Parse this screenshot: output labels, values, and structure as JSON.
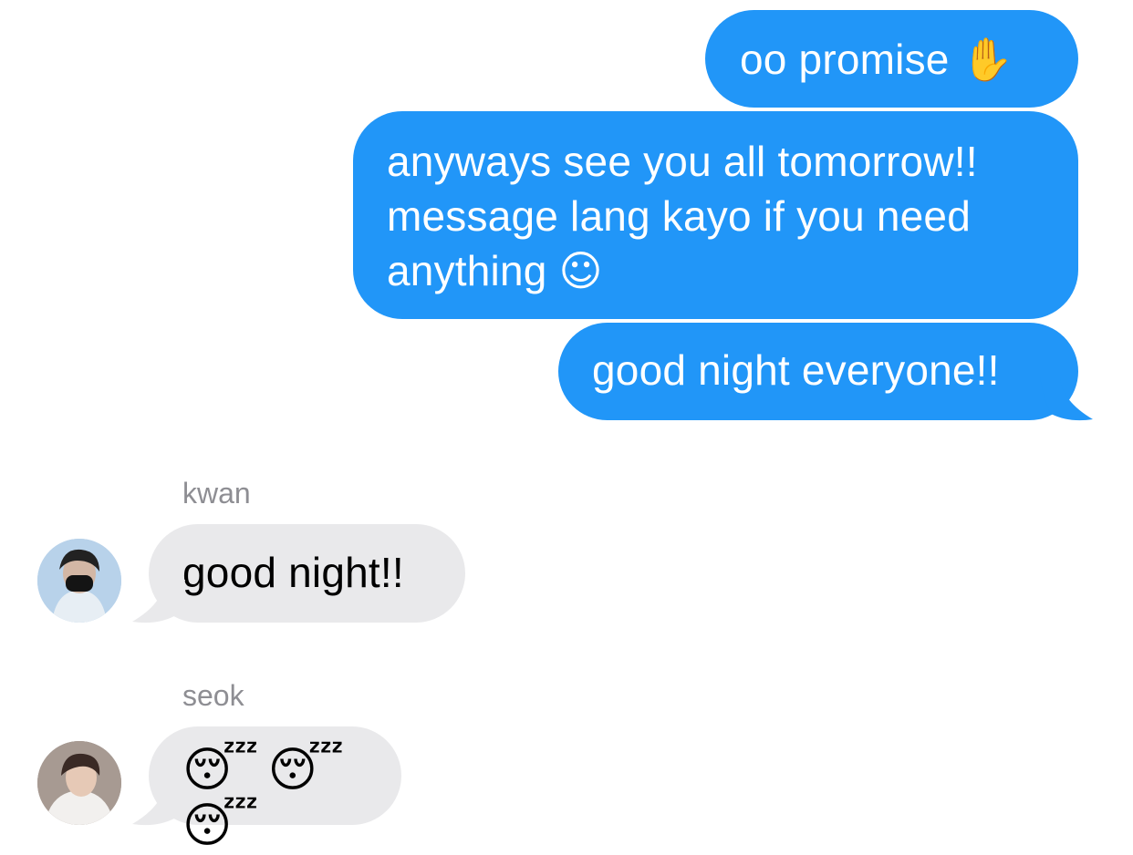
{
  "messages": {
    "outgoing": [
      {
        "text": "oo promise",
        "emoji": "✋"
      },
      {
        "lines": [
          "anyways see you all tomorrow!!",
          "message lang kayo if you need",
          "anything"
        ],
        "emoji": "☺"
      },
      {
        "text": "good night everyone!!"
      }
    ],
    "incoming": [
      {
        "sender": "kwan",
        "text": "good night!!"
      },
      {
        "sender": "seok",
        "emoji": [
          "😴",
          "😴",
          "😴"
        ]
      }
    ]
  },
  "colors": {
    "outgoing_bubble": "#2196f8",
    "incoming_bubble": "#e9e9eb",
    "sender_name": "#8e8e93"
  },
  "icons": {
    "raised_hand": "raised-hand-icon",
    "smiling_face": "smiling-face-icon",
    "sleeping_face": "sleeping-face-icon"
  }
}
